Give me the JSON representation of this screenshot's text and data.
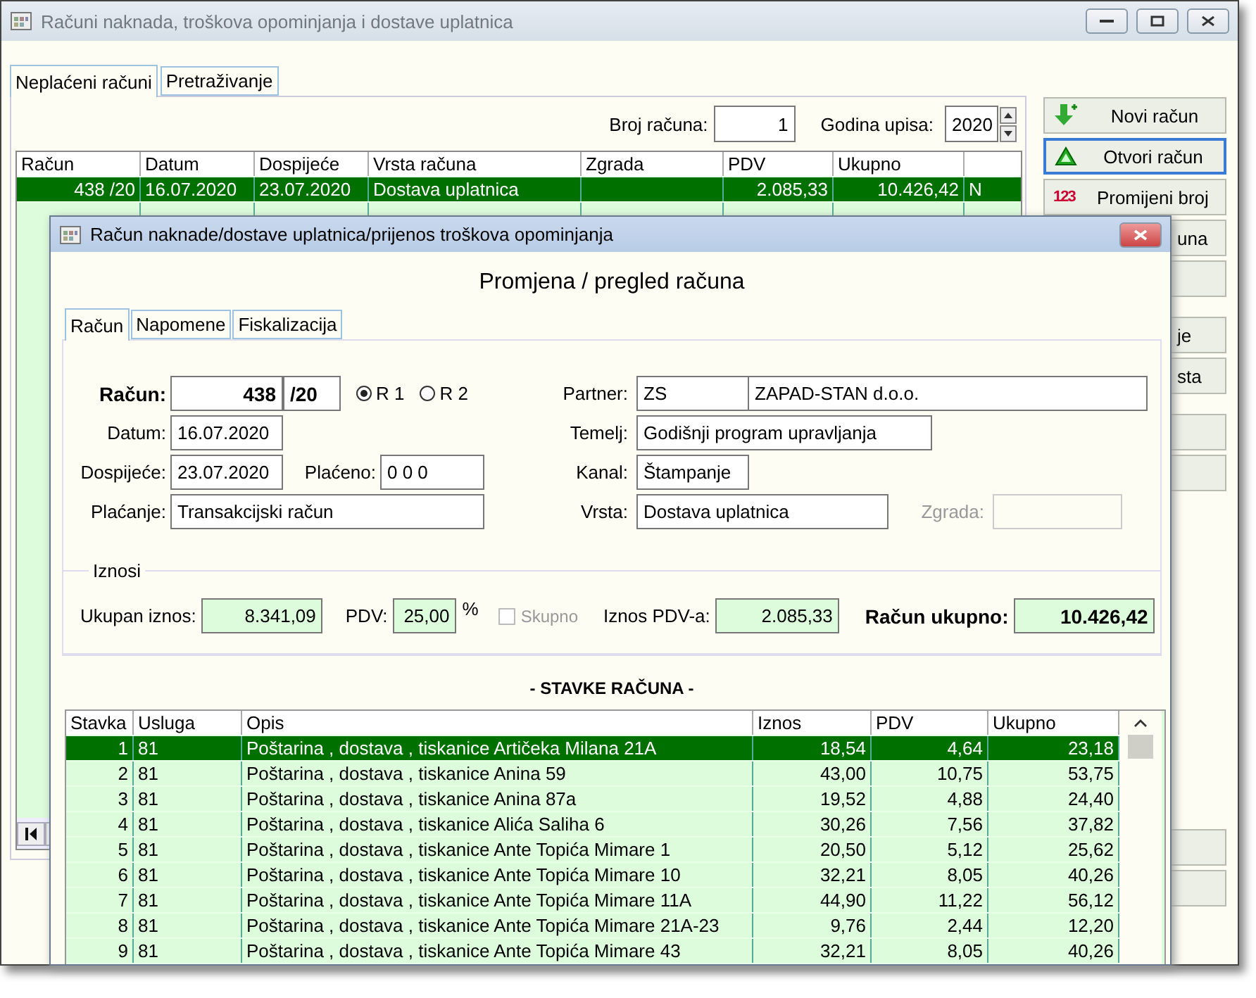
{
  "window": {
    "title": "Računi naknada, troškova opominjanja i dostave uplatnica"
  },
  "tabs": [
    {
      "label": "Neplaćeni računi",
      "selected": true
    },
    {
      "label": "Pretraživanje",
      "selected": false
    }
  ],
  "filter": {
    "number_label": "Broj računa:",
    "number_value": "1",
    "year_label": "Godina upisa:",
    "year_value": "2020"
  },
  "table": {
    "columns": [
      "Račun",
      "Datum",
      "Dospijeće",
      "Vrsta računa",
      "Zgrada",
      "PDV",
      "Ukupno"
    ],
    "rows": [
      {
        "selected": true,
        "cells": [
          "438 /20",
          "16.07.2020",
          "23.07.2020",
          "Dostava uplatnica",
          "",
          "2.085,33",
          "10.426,42",
          "N"
        ]
      }
    ]
  },
  "button_groups": [
    [
      {
        "kind": "add",
        "label": "Novi račun",
        "focused": false
      },
      {
        "kind": "open",
        "label": "Otvori račun",
        "focused": true
      },
      {
        "kind": "renumber",
        "label": "Promijeni broj",
        "icon_text": "123",
        "focused": false
      },
      {
        "kind": "plain",
        "label": "una",
        "focused": false
      },
      {
        "kind": "blank",
        "focused": false
      }
    ],
    [
      {
        "kind": "plain",
        "label": "je",
        "focused": false
      },
      {
        "kind": "plain",
        "label": "sta",
        "focused": false
      }
    ],
    [
      {
        "kind": "blank",
        "focused": false
      },
      {
        "kind": "blank",
        "focused": false
      }
    ],
    [
      {
        "kind": "blank",
        "focused": false
      },
      {
        "kind": "blank",
        "focused": false
      }
    ]
  ],
  "dialog": {
    "title": "Račun naknade/dostave uplatnica/prijenos troškova opominjanja",
    "heading": "Promjena / pregled računa",
    "tabs": [
      {
        "label": "Račun",
        "selected": true
      },
      {
        "label": "Napomene",
        "selected": false
      },
      {
        "label": "Fiskalizacija",
        "selected": false
      }
    ],
    "form": {
      "invoice_label": "Račun:",
      "invoice_number": "438",
      "invoice_year": "/20",
      "invoice_types": [
        {
          "label": "R 1",
          "selected": true
        },
        {
          "label": "R 2",
          "selected": false
        }
      ],
      "date_label": "Datum:",
      "date": "16.07.2020",
      "due_label": "Dospijeće:",
      "due": "23.07.2020",
      "paid_label": "Plaćeno:",
      "paid": "0 0 0",
      "payment_label": "Plaćanje:",
      "payment": "Transakcijski račun",
      "partner_label": "Partner:",
      "partner_code": "ZS",
      "partner_name": "ZAPAD-STAN d.o.o.",
      "basis_label": "Temelj:",
      "basis": "Godišnji program upravljanja",
      "channel_label": "Kanal:",
      "channel": "Štampanje",
      "type_label": "Vrsta:",
      "type": "Dostava uplatnica",
      "building_label": "Zgrada:",
      "building_disabled": true
    },
    "amounts": {
      "legend": "Iznosi",
      "net_label": "Ukupan iznos:",
      "net": "8.341,09",
      "vat_label": "PDV:",
      "vat_rate": "25,00",
      "percent": "%",
      "combined": {
        "label": "Skupno",
        "checked": false,
        "disabled": true
      },
      "vat_amount_label": "Iznos PDV-a:",
      "vat_amount": "2.085,33",
      "total_label": "Račun ukupno:",
      "total": "10.426,42"
    },
    "items_title": "- STAVKE RAČUNA -",
    "items": {
      "columns": [
        "Stavka",
        "Usluga",
        "Opis",
        "Iznos",
        "PDV",
        "Ukupno"
      ],
      "rows": [
        {
          "selected": true,
          "cells": [
            "1",
            "81",
            "Poštarina , dostava , tiskanice Artičeka Milana 21A",
            "18,54",
            "4,64",
            "23,18"
          ]
        },
        {
          "selected": false,
          "cells": [
            "2",
            "81",
            "Poštarina , dostava , tiskanice Anina 59",
            "43,00",
            "10,75",
            "53,75"
          ]
        },
        {
          "selected": false,
          "cells": [
            "3",
            "81",
            "Poštarina , dostava , tiskanice Anina 87a",
            "19,52",
            "4,88",
            "24,40"
          ]
        },
        {
          "selected": false,
          "cells": [
            "4",
            "81",
            "Poštarina , dostava , tiskanice Alića Saliha 6",
            "30,26",
            "7,56",
            "37,82"
          ]
        },
        {
          "selected": false,
          "cells": [
            "5",
            "81",
            "Poštarina , dostava , tiskanice Ante Topića Mimare 1",
            "20,50",
            "5,12",
            "25,62"
          ]
        },
        {
          "selected": false,
          "cells": [
            "6",
            "81",
            "Poštarina , dostava , tiskanice Ante Topića Mimare 10",
            "32,21",
            "8,05",
            "40,26"
          ]
        },
        {
          "selected": false,
          "cells": [
            "7",
            "81",
            "Poštarina , dostava , tiskanice Ante Topića Mimare 11A",
            "44,90",
            "11,22",
            "56,12"
          ]
        },
        {
          "selected": false,
          "cells": [
            "8",
            "81",
            "Poštarina , dostava , tiskanice Ante Topića Mimare 21A-23",
            "9,76",
            "2,44",
            "12,20"
          ]
        },
        {
          "selected": false,
          "cells": [
            "9",
            "81",
            "Poštarina , dostava , tiskanice Ante Topića Mimare 43",
            "32,21",
            "8,05",
            "40,26"
          ]
        }
      ]
    }
  }
}
